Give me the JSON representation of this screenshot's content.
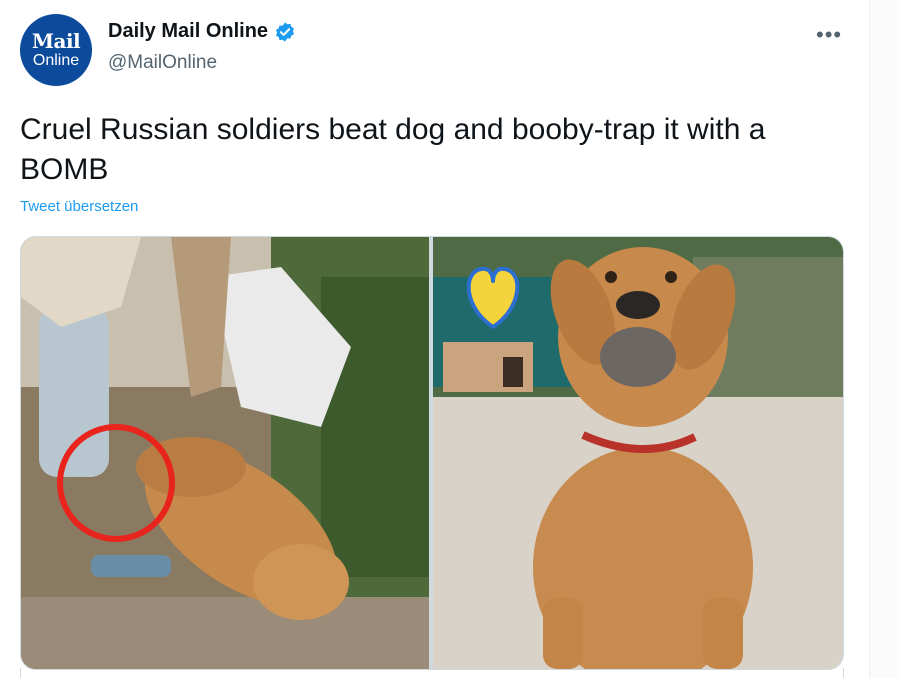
{
  "tweet": {
    "author_name": "Daily Mail Online",
    "author_handle": "@MailOnline",
    "avatar": {
      "line1": "Mail",
      "line2": "Online"
    },
    "text": "Cruel Russian soldiers beat dog and booby-trap it with a BOMB",
    "translate_link": "Tweet übersetzen",
    "more_label": "•••"
  },
  "colors": {
    "brand_blue": "#0c4a9c",
    "link_blue": "#1d9bf0",
    "verified_blue": "#1d9bf0",
    "highlight_circle": "#e8241c",
    "heart_yellow": "#f5d33c",
    "heart_blue": "#2d6fd0"
  },
  "icons": [
    "verified-badge-icon",
    "more-options-icon",
    "heart-icon"
  ]
}
